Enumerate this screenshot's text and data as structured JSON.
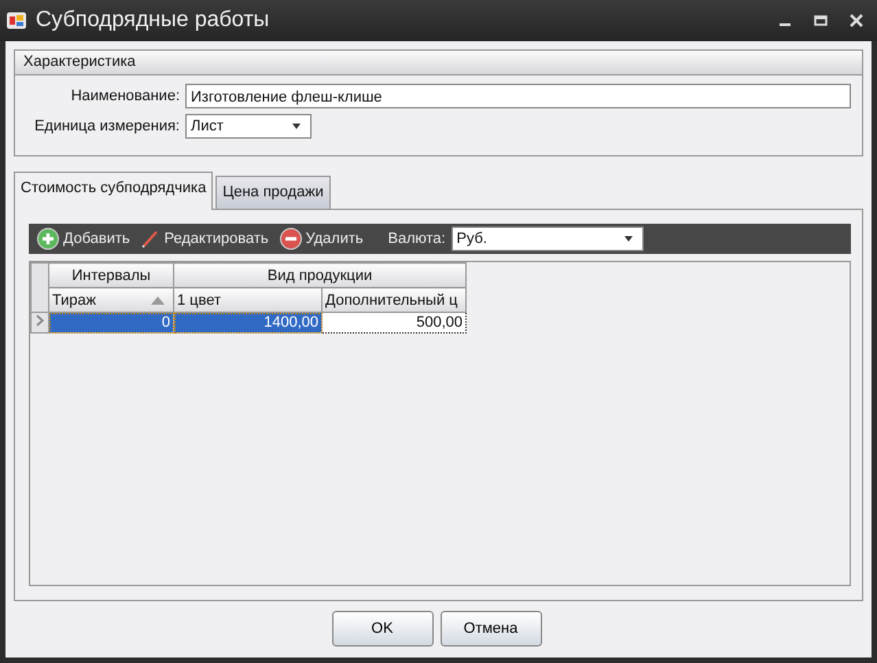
{
  "window": {
    "title": "Субподрядные работы"
  },
  "characteristics": {
    "title": "Характеристика",
    "name_label": "Наименование:",
    "name_value": "Изготовление флеш-клише",
    "unit_label": "Единица измерения:",
    "unit_value": "Лист"
  },
  "tabs": [
    {
      "label": "Стоимость субподрядчика",
      "selected": true
    },
    {
      "label": "Цена продажи",
      "selected": false
    }
  ],
  "toolbar": {
    "add": "Добавить",
    "edit": "Редактировать",
    "delete": "Удалить",
    "currency_label": "Валюта:",
    "currency_value": "Руб."
  },
  "table": {
    "bands": [
      {
        "label": "Интервалы"
      },
      {
        "label": "Вид продукции"
      }
    ],
    "columns": [
      {
        "label": "Тираж",
        "sorted": true
      },
      {
        "label": "1 цвет",
        "sorted": false
      },
      {
        "label": "Дополнительный ц",
        "sorted": false
      }
    ],
    "rows": [
      {
        "cells": [
          "0",
          "1400,00",
          "500,00"
        ],
        "selected": true
      }
    ]
  },
  "buttons": [
    "OK",
    "Отмена"
  ]
}
